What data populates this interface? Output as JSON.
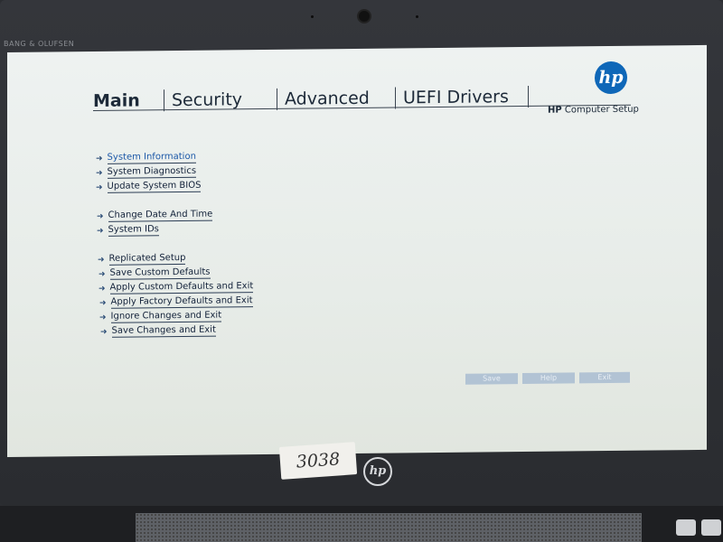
{
  "bezel": {
    "brand_text": "BANG & OLUFSEN",
    "sticker_text": "3038",
    "logo_text": "hp"
  },
  "header": {
    "tabs": [
      {
        "label": "Main"
      },
      {
        "label": "Security"
      },
      {
        "label": "Advanced"
      },
      {
        "label": "UEFI Drivers"
      }
    ],
    "logo_text": "hp",
    "setup_brand": "HP",
    "setup_label": "Computer Setup"
  },
  "menu": {
    "items": [
      {
        "label": "System Information",
        "selected": true
      },
      {
        "label": "System Diagnostics"
      },
      {
        "label": "Update System BIOS"
      },
      {
        "label": "Change Date And Time"
      },
      {
        "label": "System IDs"
      },
      {
        "label": "Replicated Setup"
      },
      {
        "label": "Save Custom Defaults"
      },
      {
        "label": "Apply Custom Defaults and Exit"
      },
      {
        "label": "Apply Factory Defaults and Exit"
      },
      {
        "label": "Ignore Changes and Exit"
      },
      {
        "label": "Save Changes and Exit"
      }
    ]
  },
  "buttons": {
    "save": "Save",
    "help": "Help",
    "exit": "Exit"
  },
  "colors": {
    "accent": "#1e5aa8",
    "hp_blue": "#0f67b8",
    "button_disabled": "#b2c3d4"
  }
}
